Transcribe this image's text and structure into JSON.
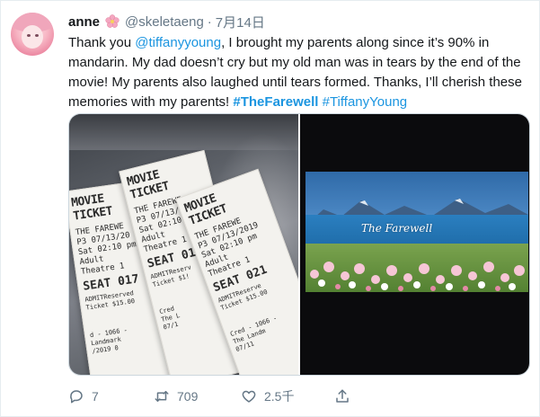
{
  "tweet": {
    "author_name": "anne",
    "author_emoji": "🌸",
    "handle": "@skeletaeng",
    "separator": "·",
    "date": "7月14日",
    "text": {
      "p1": "Thank you ",
      "mention": "@tiffanyyoung",
      "p2": ", I brought my parents along since it’s 90% in mandarin. My dad doesn’t cry but my old man was in tears by the end of the movie! My parents also laughed until tears formed. Thanks, I’ll cherish these memories with my parents! ",
      "hashtag1": "#TheFarewell",
      "hashtag2": "#TiffanyYoung"
    }
  },
  "media": {
    "tickets": [
      {
        "title": "MOVIE TICKET",
        "film": "THE FAREWE",
        "line_p": "P3  07/13/20",
        "line_s": "Sat 02:10 pm",
        "type": "Adult",
        "theatre": "Theatre 1",
        "seat": "SEAT 017",
        "admit": "ADMITReserved",
        "price": "Ticket $15.00",
        "foot1": "d - 1066 -",
        "foot2": "Landmark",
        "foot3": "/2019 0"
      },
      {
        "title": "MOVIE TICKET",
        "film": "THE FAREWE",
        "line_p": "P3  07/13/201",
        "line_s": "Sat 02:10 p",
        "type": "Adult",
        "theatre": "Theatre 1",
        "seat": "SEAT 019",
        "admit": "ADMITReserv",
        "price": "Ticket $1!",
        "foot1": "Cred",
        "foot2": "The L",
        "foot3": "07/1"
      },
      {
        "title": "MOVIE TICKET",
        "film": "THE FAREWE",
        "line_p": "P3  07/13/2019",
        "line_s": "Sat 02:10 pm",
        "type": "Adult",
        "theatre": "Theatre 1",
        "seat": "SEAT 021",
        "admit": "ADMITReserve",
        "price": "Ticket $15.00",
        "foot1": "Cred - 1066 -",
        "foot2": "The Landm",
        "foot3": "07/11"
      }
    ],
    "screen_title": "The Farewell"
  },
  "actions": {
    "reply_count": "7",
    "retweet_count": "709",
    "like_count": "2.5千",
    "colors": {
      "icon": "#657786",
      "link": "#1b95e0"
    }
  }
}
